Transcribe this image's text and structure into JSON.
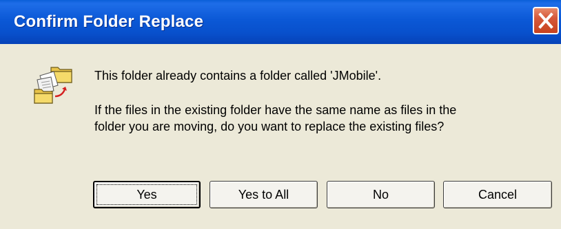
{
  "window": {
    "title": "Confirm Folder Replace"
  },
  "titlebar": {
    "close_icon": "close-icon"
  },
  "message": {
    "icon": "folder-replace-icon",
    "line1": "This folder already contains a folder called 'JMobile'.",
    "line2": "If the files in the existing folder have the same name as files in the",
    "line3": "folder you are moving, do you want to replace the existing files?"
  },
  "buttons": {
    "yes": "Yes",
    "yes_to_all": "Yes to All",
    "no": "No",
    "cancel": "Cancel"
  },
  "colors": {
    "titlebar": "#0b58d6",
    "dialog_body": "#ece9d8",
    "close_button": "#d5583a"
  }
}
